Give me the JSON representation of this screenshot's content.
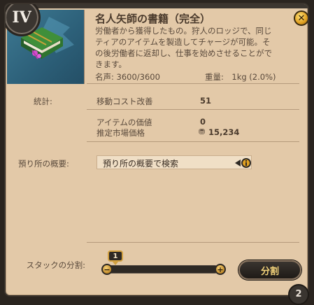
{
  "item": {
    "tier": "IV",
    "title": "名人矢師の書籍（完全）",
    "description_lines": [
      "労働者から獲得したもの。狩人のロッジで、同じ",
      "ティアのアイテムを製造してチャージが可能。そ",
      "の後労働者に返却し、仕事を始めさせることがで",
      "きます。"
    ],
    "fame": "名声: 3600/3600",
    "weight": "重量:　1kg (2.0%)"
  },
  "stats": {
    "section_label": "統計:",
    "move_cost_label": "移動コスト改善",
    "move_cost_value": "51",
    "item_value_label": "アイテムの価値",
    "item_value_value": "0",
    "market_price_label": "推定市場価格",
    "market_price_value": "15,234"
  },
  "depot": {
    "section_label": "預り所の概要:",
    "search_text": "預り所の概要で検索"
  },
  "stack": {
    "label": "スタックの分割:",
    "bubble_value": "1",
    "split_button": "分割",
    "corner_badge": "2"
  },
  "colors": {
    "panel": "#e3c9a8",
    "thumb": "#2c5f78",
    "gold": "#e0a020",
    "dark": "#2e2924"
  },
  "icons": {
    "close": "close-icon",
    "info": "info-icon",
    "silver": "silver-coin-icon",
    "book": "book-icon"
  }
}
